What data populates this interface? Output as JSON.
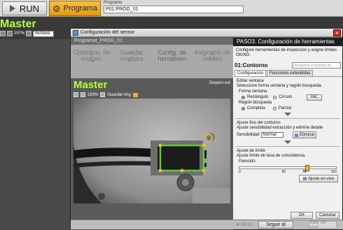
{
  "topbar": {
    "run_label": "RUN",
    "program_label": "Programa",
    "program_caption": "Programa",
    "program_value": "P01:PROG_01"
  },
  "background": {
    "master_title": "Master",
    "zoom": "297%",
    "window_select": "Ventana"
  },
  "dialog": {
    "title": "Configuración del sensor",
    "program_name": "Programat_PROG_01",
    "steps": [
      {
        "num": "1",
        "label": "Optimizac de imagen"
      },
      {
        "num": "2",
        "label": "Guardar maestra"
      },
      {
        "num": "3",
        "label": "Config. de herramien"
      },
      {
        "num": "4",
        "label": "Asignació de salidas"
      }
    ],
    "master_title": "Master",
    "display_ext": "Dispers ext",
    "zoom": "183%",
    "save_image": "Guardar img",
    "footer": {
      "back": "◄ Atrás",
      "next": "Seguir al",
      "exit": "Salir do conf"
    }
  },
  "right_panel": {
    "header": "PASO3. Configuración de herramientas",
    "description": "Configure herramientas de inspección y asigne límites OK/NG.",
    "tool_name": "01:Contorno",
    "name_hint": "Introduzca el nombre de",
    "tabs": [
      "Configuración",
      "Funciones extendidas"
    ],
    "window_section": {
      "heading": "Editar ventana",
      "subheading": "Seleccione forma ventana y región búsqueda.",
      "shape_label": "Forma ventana",
      "shape_options": [
        "Rectángulo",
        "Círculo"
      ],
      "shape_selected": "Rectángulo",
      "init_button": "Inic.",
      "region_label": "Región búsqueda",
      "region_options": [
        "Completa",
        "Parcial"
      ],
      "region_selected": "Completa"
    },
    "contour_section": {
      "heading": "Ajuste fino del contorno",
      "subheading": "Ajuste sensibilidad extracción y elimine detalle",
      "sensitivity_label": "Sensibilidad",
      "sensitivity_value": "Normal",
      "delete_button": "Eliminar"
    },
    "limit_section": {
      "heading": "Ajuste de límite",
      "subheading": "Ajuste límite de tasa de coincidencia.",
      "similarity_label": "Parecido",
      "slider_min": "0",
      "slider_mid": "50",
      "slider_max": "100",
      "slider_value": "70",
      "live_button": "Ajuste en vivo"
    },
    "ok_button": "OK",
    "cancel_button": "Cancelar"
  }
}
